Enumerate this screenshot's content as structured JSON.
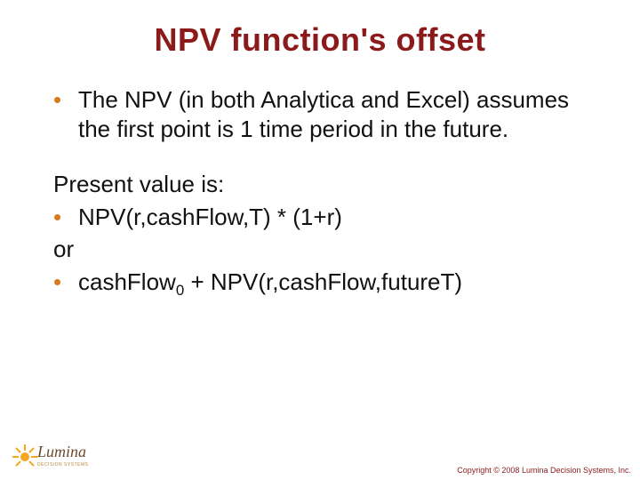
{
  "title": "NPV function's offset",
  "bullets1": [
    "The NPV (in both Analytica and Excel) assumes the first point is 1 time period in the future."
  ],
  "plain1": "Present value is:",
  "bullets2": [
    "NPV(r,cashFlow,T) * (1+r)"
  ],
  "plain2": "or",
  "bullets3": [
    {
      "pre": "cashFlow",
      "sub": "0",
      "post": " + NPV(r,cashFlow,futureT)"
    }
  ],
  "logo": {
    "main": "Lumina",
    "sub": "DECISION SYSTEMS"
  },
  "copyright": "Copyright © 2008 Lumina Decision Systems, Inc."
}
